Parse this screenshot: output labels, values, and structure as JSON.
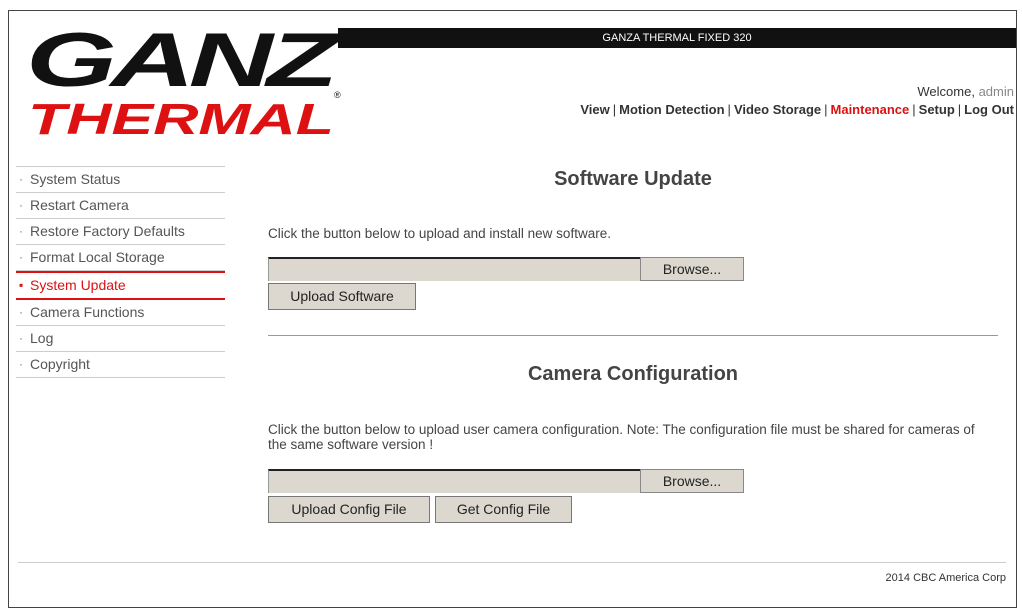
{
  "header": {
    "logo_top": "GANZ",
    "logo_bottom": "THERMAL",
    "device_title": "GANZA THERMAL FIXED 320",
    "welcome_prefix": "Welcome,",
    "user": "admin",
    "nav": [
      "View",
      "Motion Detection",
      "Video Storage",
      "Maintenance",
      "Setup",
      "Log Out"
    ],
    "active_nav": "Maintenance"
  },
  "sidebar": {
    "items": [
      {
        "label": "System Status"
      },
      {
        "label": "Restart Camera"
      },
      {
        "label": "Restore Factory Defaults"
      },
      {
        "label": "Format Local Storage"
      },
      {
        "label": "System Update"
      },
      {
        "label": "Camera Functions"
      },
      {
        "label": "Log"
      },
      {
        "label": "Copyright"
      }
    ],
    "active_index": 4
  },
  "software_update": {
    "title": "Software Update",
    "description": "Click the button below to upload and install new software.",
    "browse_label": "Browse...",
    "upload_label": "Upload Software"
  },
  "camera_config": {
    "title": "Camera Configuration",
    "description": "Click the button below to upload user camera configuration. Note: The configuration file must be shared for cameras of the same software version !",
    "browse_label": "Browse...",
    "upload_label": "Upload Config File",
    "get_label": "Get Config File"
  },
  "footer": {
    "text": "2014 CBC America Corp"
  },
  "colors": {
    "accent": "#dd1111",
    "button_bg": "#dcd8cf"
  }
}
